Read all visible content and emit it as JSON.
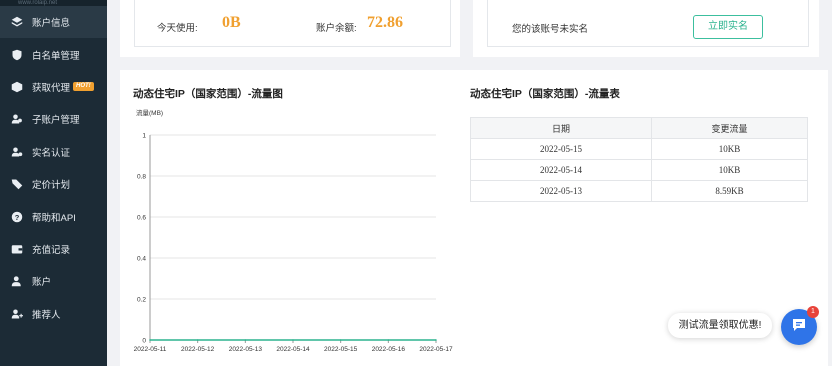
{
  "sidebar": {
    "brand_url": "www.rolaip.net",
    "items": [
      {
        "label": "账户信息",
        "icon": "layers-icon",
        "active": true
      },
      {
        "label": "白名单管理",
        "icon": "shield-icon"
      },
      {
        "label": "获取代理",
        "icon": "cube-icon",
        "badge": "HOT!"
      },
      {
        "label": "子账户管理",
        "icon": "users-icon"
      },
      {
        "label": "实名认证",
        "icon": "user-check-icon"
      },
      {
        "label": "定价计划",
        "icon": "tag-icon"
      },
      {
        "label": "帮助和API",
        "icon": "question-icon"
      },
      {
        "label": "充值记录",
        "icon": "wallet-icon"
      },
      {
        "label": "账户",
        "icon": "user-icon"
      },
      {
        "label": "推荐人",
        "icon": "user-plus-icon"
      }
    ]
  },
  "usage_card": {
    "today_label": "今天使用:",
    "today_value": "0B",
    "balance_label": "账户余额:",
    "balance_value": "72.86"
  },
  "realname_card": {
    "message": "您的该账号未实名",
    "button_label": "立即实名"
  },
  "chart_section": {
    "title": "动态住宅IP（国家范围）-流量图"
  },
  "table_section": {
    "title": "动态住宅IP（国家范围）-流量表"
  },
  "chart_data": {
    "type": "line",
    "ylabel": "流量(MB)",
    "ylim": [
      0,
      1
    ],
    "yticks": [
      "0",
      "0.2",
      "0.4",
      "0.6",
      "0.8",
      "1"
    ],
    "categories": [
      "2022-05-11",
      "2022-05-12",
      "2022-05-13",
      "2022-05-14",
      "2022-05-15",
      "2022-05-16",
      "2022-05-17"
    ],
    "values": [
      0,
      0,
      0,
      0,
      0,
      0,
      0
    ],
    "line_color": "#2db38f"
  },
  "flow_table": {
    "headers": [
      "日期",
      "变更流量"
    ],
    "rows": [
      [
        "2022-05-15",
        "10KB"
      ],
      [
        "2022-05-14",
        "10KB"
      ],
      [
        "2022-05-13",
        "8.59KB"
      ]
    ]
  },
  "chat": {
    "tip": "测试流量领取优惠!",
    "badge": "1"
  }
}
